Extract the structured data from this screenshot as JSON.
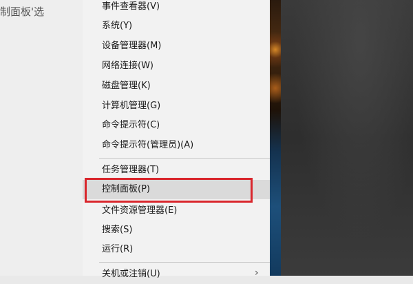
{
  "background": {
    "left_caption": "制面板'选"
  },
  "context_menu": {
    "items": [
      {
        "label": "事件查看器(V)"
      },
      {
        "label": "系统(Y)"
      },
      {
        "label": "设备管理器(M)"
      },
      {
        "label": "网络连接(W)"
      },
      {
        "label": "磁盘管理(K)"
      },
      {
        "label": "计算机管理(G)"
      },
      {
        "label": "命令提示符(C)"
      },
      {
        "label": "命令提示符(管理员)(A)"
      },
      {
        "label": "任务管理器(T)"
      },
      {
        "label": "控制面板(P)",
        "highlighted": true
      },
      {
        "label": "文件资源管理器(E)"
      },
      {
        "label": "搜索(S)"
      },
      {
        "label": "运行(R)"
      },
      {
        "label": "关机或注销(U)",
        "has_submenu": true
      }
    ]
  },
  "annotation": {
    "box_color": "#d9262c",
    "target": "控制面板(P)"
  },
  "icons": {
    "submenu_arrow": "chevron-right-icon"
  }
}
